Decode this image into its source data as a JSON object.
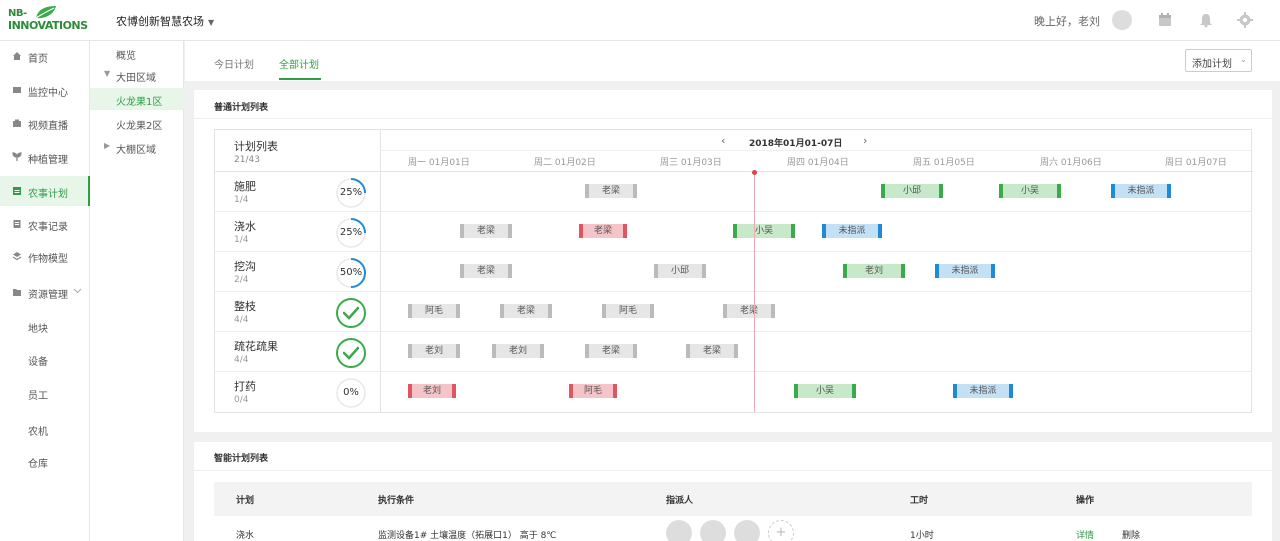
{
  "brand": {
    "line1": "NB-",
    "line2": "INNOVATIONS"
  },
  "farm_name": "农博创新智慧农场",
  "greeting": "晚上好，老刘",
  "sidebar": {
    "items": [
      {
        "label": "首页",
        "icon": "home-icon"
      },
      {
        "label": "监控中心",
        "icon": "monitor-icon"
      },
      {
        "label": "视频直播",
        "icon": "camera-icon"
      },
      {
        "label": "种植管理",
        "icon": "sprout-icon"
      },
      {
        "label": "农事计划",
        "icon": "calendar-icon"
      },
      {
        "label": "农事记录",
        "icon": "record-icon"
      },
      {
        "label": "作物模型",
        "icon": "layers-icon"
      },
      {
        "label": "资源管理",
        "icon": "folder-icon"
      }
    ],
    "sub_items": [
      "地块",
      "设备",
      "员工",
      "农机",
      "仓库"
    ]
  },
  "tree": {
    "overview": "概览",
    "field_zone": "大田区域",
    "zone1": "火龙果1区",
    "zone2": "火龙果2区",
    "greenhouse": "大棚区域"
  },
  "tabs": {
    "today": "今日计划",
    "all": "全部计划"
  },
  "add_plan": "添加计划",
  "normal_list_title": "普通计划列表",
  "gantt": {
    "header_title": "计划列表",
    "header_count": "21/43",
    "range": "2018年01月01-07日",
    "days": [
      "周一 01月01日",
      "周二 01月02日",
      "周三 01月03日",
      "周四 01月04日",
      "周五 01月05日",
      "周六 01月06日",
      "周日 01月07日"
    ],
    "rows": [
      {
        "name": "施肥",
        "count": "1/4",
        "progress": "25%",
        "frac": 0.25
      },
      {
        "name": "浇水",
        "count": "1/4",
        "progress": "25%",
        "frac": 0.25
      },
      {
        "name": "挖沟",
        "count": "2/4",
        "progress": "50%",
        "frac": 0.5
      },
      {
        "name": "整枝",
        "count": "4/4",
        "progress": "",
        "frac": 1
      },
      {
        "name": "疏花疏果",
        "count": "4/4",
        "progress": "",
        "frac": 1
      },
      {
        "name": "打药",
        "count": "0/4",
        "progress": "0%",
        "frac": 0
      }
    ]
  },
  "smart_list_title": "智能计划列表",
  "smart_table": {
    "headers": [
      "计划",
      "执行条件",
      "指派人",
      "工时",
      "操作"
    ],
    "row": {
      "plan": "浇水",
      "condition": "监测设备1#  土壤温度（拓展口1）  高于  8℃",
      "hours": "1小时",
      "detail": "详情",
      "delete": "删除"
    }
  },
  "colors": {
    "accent": "#2e9e44",
    "blue": "#1f8ad6",
    "red": "#e05562"
  }
}
